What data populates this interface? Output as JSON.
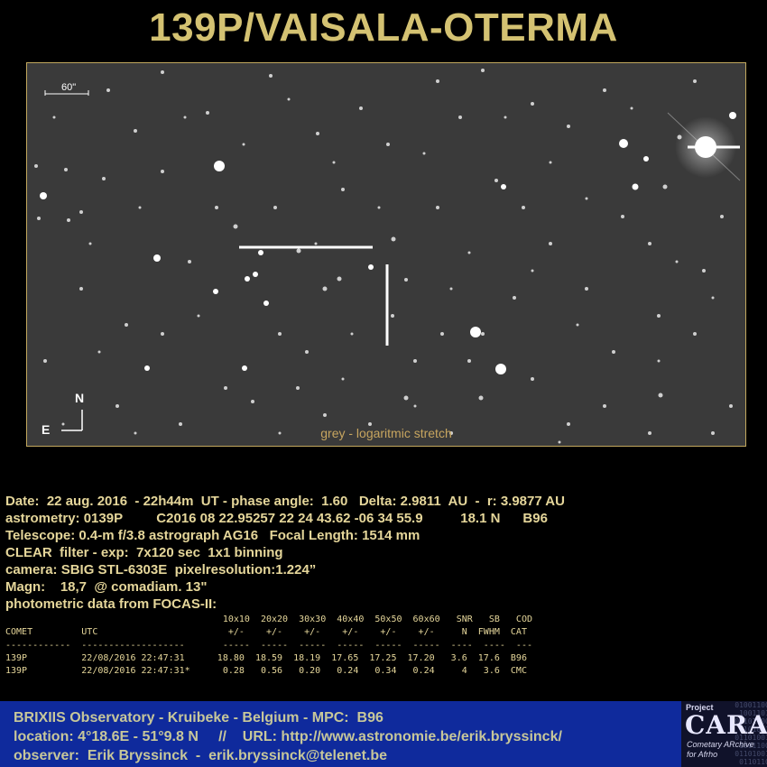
{
  "title": "139P/VAISALA-OTERMA",
  "image": {
    "scale_label": "60\"",
    "caption": "grey - logaritmic stretch",
    "compass_n": "N",
    "compass_e": "E"
  },
  "info_lines": [
    "Date:  22 aug. 2016  - 22h44m  UT - phase angle:  1.60   Delta: 2.9811  AU  -  r: 3.9877 AU",
    "astrometry: 0139P         C2016 08 22.95257 22 24 43.62 -06 34 55.9          18.1 N      B96",
    "Telescope: 0.4-m f/3.8 astrograph AG16   Focal Length: 1514 mm",
    "CLEAR  filter - exp:  7x120 sec  1x1 binning",
    "camera: SBIG STL-6303E  pixelresolution:1.224”",
    "Magn:    18,7  @ comadiam. 13\"",
    "photometric data from FOCAS-II:"
  ],
  "photometry": {
    "header1": "                                        10x10  20x20  30x30  40x40  50x50  60x60   SNR   SB   COD",
    "header2": "COMET         UTC                        +/-    +/-    +/-    +/-    +/-    +/-     N  FWHM  CAT",
    "separator": "------------  -------------------       -----  -----  -----  -----  -----  -----  ----  ----  ---",
    "rows": [
      "139P          22/08/2016 22:47:31      18.80  18.59  18.19  17.65  17.25  17.20   3.6  17.6  B96",
      "139P          22/08/2016 22:47:31*      0.28   0.56   0.20   0.24   0.34   0.24     4   3.6  CMC"
    ]
  },
  "footer": {
    "line1": "BRIXIIS Observatory - Kruibeke - Belgium - MPC:  B96",
    "line2": "location: 4°18.6E - 51°9.8 N     //    URL: http://www.astronomie.be/erik.bryssinck/",
    "line3": "observer:  Erik Bryssinck  -  erik.bryssinck@telenet.be"
  },
  "logo": {
    "project": "Project",
    "name": "CARA",
    "sub1": "Cometary ARchive",
    "sub2": "for Afrho"
  }
}
